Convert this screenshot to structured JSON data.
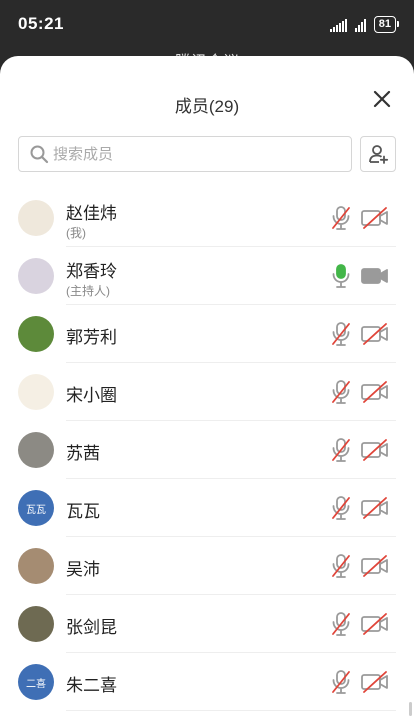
{
  "status_bar": {
    "time": "05:21",
    "battery": "81"
  },
  "background_title": "腾讯会议",
  "sheet": {
    "title": "成员(29)",
    "search_placeholder": "搜索成员"
  },
  "members": [
    {
      "name": "赵佳炜",
      "subtitle": "(我)",
      "mic": "muted",
      "camera": "off",
      "avatar_text": "",
      "avatar_color": "#efe8dc"
    },
    {
      "name": "郑香玲",
      "subtitle": "(主持人)",
      "mic": "on",
      "camera": "on",
      "avatar_text": "",
      "avatar_color": "#d9d3df"
    },
    {
      "name": "郭芳利",
      "subtitle": "",
      "mic": "muted",
      "camera": "off",
      "avatar_text": "",
      "avatar_color": "#5d8a3a"
    },
    {
      "name": "宋小圈",
      "subtitle": "",
      "mic": "muted",
      "camera": "off",
      "avatar_text": "",
      "avatar_color": "#f5efe4"
    },
    {
      "name": "苏茜",
      "subtitle": "",
      "mic": "muted",
      "camera": "off",
      "avatar_text": "",
      "avatar_color": "#8c8a84"
    },
    {
      "name": "瓦瓦",
      "subtitle": "",
      "mic": "muted",
      "camera": "off",
      "avatar_text": "瓦瓦",
      "avatar_color": "#3f6fb5"
    },
    {
      "name": "吴沛",
      "subtitle": "",
      "mic": "muted",
      "camera": "off",
      "avatar_text": "",
      "avatar_color": "#a58c72"
    },
    {
      "name": "张剑昆",
      "subtitle": "",
      "mic": "muted",
      "camera": "off",
      "avatar_text": "",
      "avatar_color": "#6e6a52"
    },
    {
      "name": "朱二喜",
      "subtitle": "",
      "mic": "muted",
      "camera": "off",
      "avatar_text": "二喜",
      "avatar_color": "#3f6fb5"
    }
  ],
  "colors": {
    "muted_red": "#e0453a",
    "active_green": "#43b649",
    "icon_gray": "#9a9a9a"
  }
}
